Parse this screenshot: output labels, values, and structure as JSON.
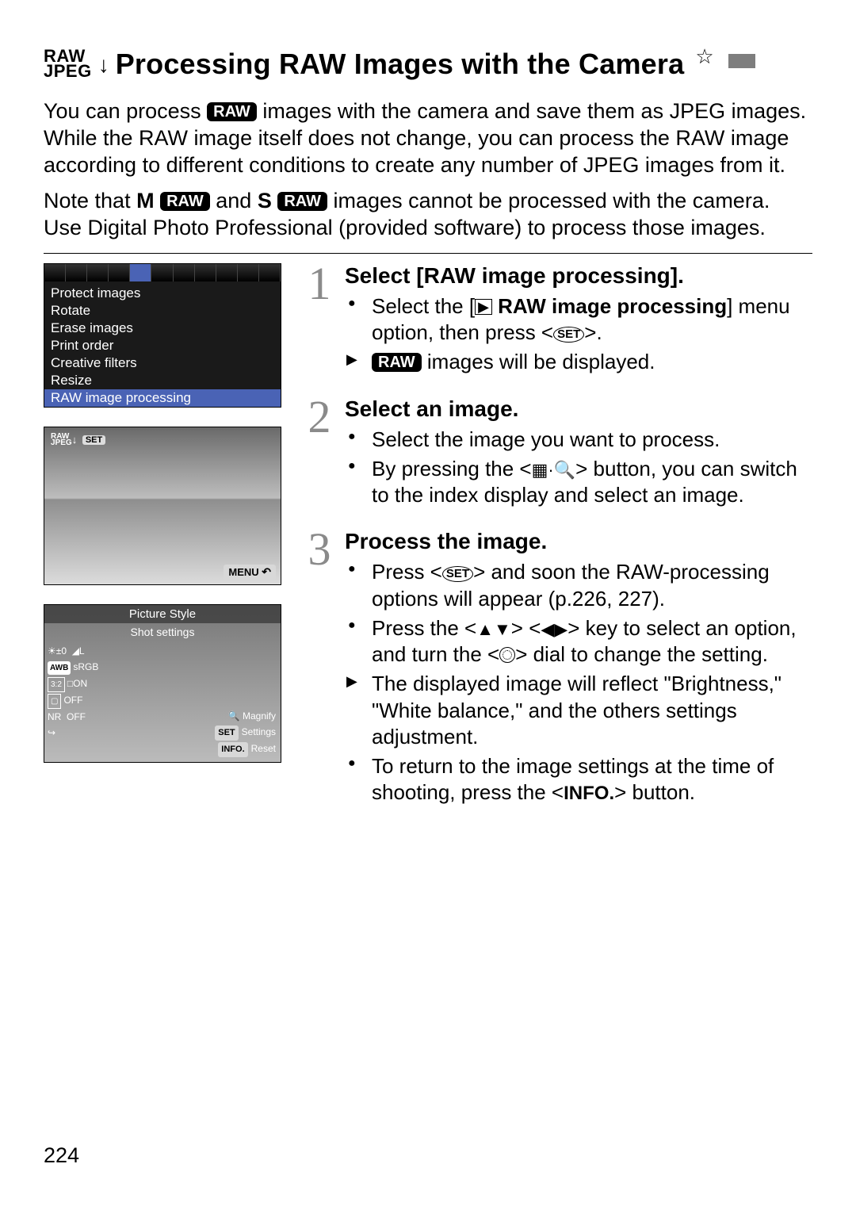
{
  "title_icon": {
    "top": "RAW",
    "bottom": "JPEG",
    "arrow": "↓"
  },
  "page_title": "Processing RAW Images with the Camera",
  "star": "☆",
  "intro": {
    "p1_a": "You can process ",
    "p1_raw": "RAW",
    "p1_b": " images with the camera and save them as JPEG images. While the RAW image itself does not change, you can process the RAW image according to different conditions to create any number of JPEG images from it.",
    "p2_a": "Note that ",
    "p2_m": "M",
    "p2_raw1": "RAW",
    "p2_and": " and ",
    "p2_s": "S",
    "p2_raw2": "RAW",
    "p2_b": " images cannot be processed with the camera. Use Digital Photo Professional (provided software) to process those images."
  },
  "panel1": {
    "items": [
      "Protect images",
      "Rotate",
      "Erase images",
      "Print order",
      "Creative filters",
      "Resize",
      "RAW image processing"
    ]
  },
  "panel2": {
    "badge_top": "RAW",
    "badge_bottom": "JPEG",
    "badge_arrow": "↓",
    "set": "SET",
    "menu": "MENU",
    "undo": "↶"
  },
  "panel3": {
    "hdr": "Picture Style",
    "sub": "Shot settings",
    "rows": [
      {
        "a": "☀±0",
        "b": "◢L"
      },
      {
        "a": "AWB",
        "b": "sRGB"
      },
      {
        "a": "3:2",
        "b": "□ON"
      },
      {
        "a": "▢",
        "b": "OFF"
      },
      {
        "a": "NR",
        "b": "OFF"
      },
      {
        "a": "",
        "b": "↪"
      }
    ],
    "magnify_icon": "🔍",
    "magnify": "Magnify",
    "set": "SET",
    "settings": "Settings",
    "info": "INFO.",
    "reset": "Reset"
  },
  "steps": {
    "s1": {
      "num": "1",
      "title": "Select [RAW image processing].",
      "b1_a": "Select the [",
      "b1_play": "▶",
      "b1_raw_label": " RAW image processing",
      "b1_b": "] menu option, then press <",
      "b1_set": "SET",
      "b1_c": ">.",
      "b2_raw": "RAW",
      "b2_b": " images will be displayed."
    },
    "s2": {
      "num": "2",
      "title": "Select an image.",
      "b1": "Select the image you want to process.",
      "b2_a": "By pressing the <",
      "b2_index": "▦·🔍",
      "b2_b": "> button, you can switch to the index display and select an image."
    },
    "s3": {
      "num": "3",
      "title": "Process the image.",
      "b1_a": "Press <",
      "b1_set": "SET",
      "b1_b": "> and soon the RAW-processing options will appear (p.226, 227).",
      "b2_a": "Press the <",
      "b2_ud": "▲▼",
      "b2_mid": "> <",
      "b2_lr": "◀▶",
      "b2_b": "> key to select an option, and turn the <",
      "b2_c": "> dial to change the setting.",
      "b3": "The displayed image will reflect \"Brightness,\" \"White balance,\" and the others settings adjustment.",
      "b4_a": "To return to the image settings at the time of shooting, press the <",
      "b4_info": "INFO.",
      "b4_b": "> button."
    }
  },
  "page_number": "224"
}
